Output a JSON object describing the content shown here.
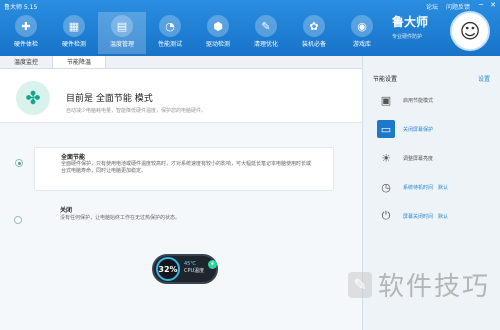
{
  "app": {
    "title": "鲁大师 5.15"
  },
  "top_links": [
    "论坛",
    "问题反馈"
  ],
  "window": {
    "minimize": "─",
    "close": "✕"
  },
  "nav": [
    {
      "label": "硬件体检",
      "icon": "health-check-icon",
      "glyph": "✚"
    },
    {
      "label": "硬件检测",
      "icon": "chip-icon",
      "glyph": "▦"
    },
    {
      "label": "温度管理",
      "icon": "thermometer-icon",
      "glyph": "▤"
    },
    {
      "label": "性能测试",
      "icon": "speedometer-icon",
      "glyph": "◔"
    },
    {
      "label": "驱动检测",
      "icon": "driver-icon",
      "glyph": "⬢"
    },
    {
      "label": "清理优化",
      "icon": "broom-icon",
      "glyph": "✎"
    },
    {
      "label": "装机必备",
      "icon": "software-icon",
      "glyph": "✿"
    },
    {
      "label": "游戏库",
      "icon": "gamepad-icon",
      "glyph": "◉"
    }
  ],
  "active_nav": "温度管理",
  "brand": {
    "name": "鲁大师",
    "slogan": "专业硬件防护"
  },
  "subtabs": [
    {
      "label": "温度监控",
      "active": false
    },
    {
      "label": "节能降温",
      "active": true
    }
  ],
  "mode": {
    "title": "目前是 全面节能 模式",
    "description": "自动减少电脑耗电量，智能降低硬件温度，保护您的电脑硬件。"
  },
  "options": {
    "full": {
      "title": "全面节能",
      "description": "全面硬件保护，只有使用电池或硬件温度较高时，才对系统速度有较小的影响，可大幅延长笔记本电脑使用时长或台式电脑寿命，同时让电脑更加稳定。",
      "selected": true
    },
    "off": {
      "title": "关闭",
      "description": "没有任何保护，让电脑始终工作在无过热保护的状态。",
      "selected": false
    }
  },
  "cpu": {
    "usage": "32%",
    "temp": "45℃",
    "label": "CPU温度"
  },
  "side": {
    "header": "节能设置",
    "settings_link": "设置",
    "items": [
      {
        "label": "启用节能模式",
        "icon": "image-icon",
        "glyph": "▣",
        "value": "",
        "link": false,
        "blue": false
      },
      {
        "label": "关闭屏幕保护",
        "icon": "monitor-icon",
        "glyph": "▭",
        "value": "",
        "link": true,
        "blue": true
      },
      {
        "label": "调整屏幕亮度",
        "icon": "brightness-icon",
        "glyph": "☀",
        "value": "",
        "link": false,
        "blue": false
      },
      {
        "label": "系统待机时间",
        "icon": "clock-icon",
        "glyph": "◷",
        "value": "默认",
        "link": true,
        "blue": false
      },
      {
        "label": "屏幕关闭时间",
        "icon": "power-icon",
        "glyph": "⏻",
        "value": "默认",
        "link": true,
        "blue": false
      }
    ]
  },
  "watermark": {
    "text": "软件技巧"
  }
}
